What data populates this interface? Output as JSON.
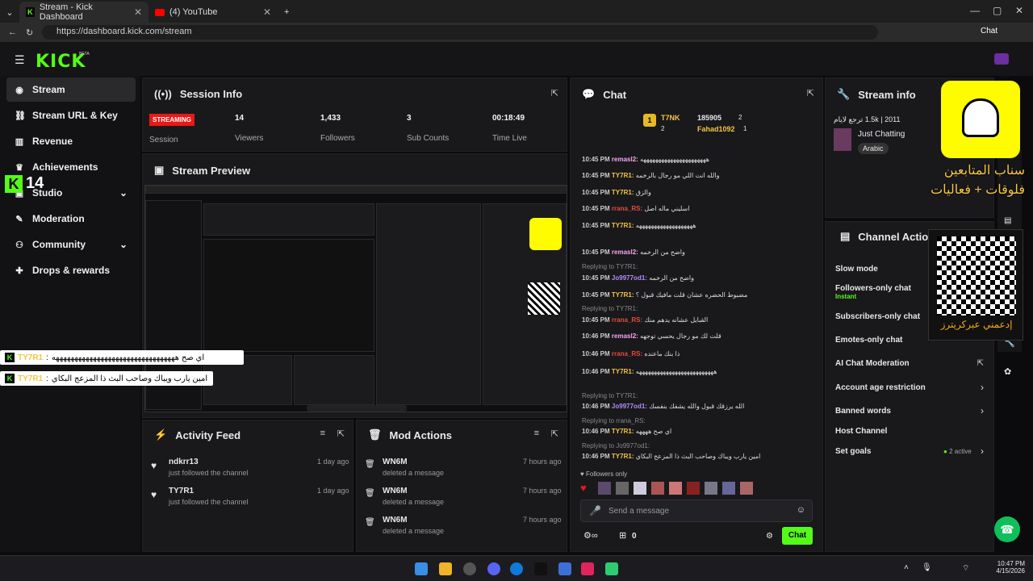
{
  "browser": {
    "tabs": [
      {
        "title": "Stream - Kick Dashboard"
      },
      {
        "title": "(4) YouTube"
      }
    ],
    "url": "https://dashboard.kick.com/stream",
    "chat_button": "Chat"
  },
  "app": {
    "logo": "KICK",
    "beta": "BETA"
  },
  "sidebar": {
    "items": [
      {
        "label": "Stream",
        "icon": "broadcast-icon"
      },
      {
        "label": "Stream URL & Key",
        "icon": "link-icon"
      },
      {
        "label": "Revenue",
        "icon": "chart-icon"
      },
      {
        "label": "Achievements",
        "icon": "trophy-icon"
      },
      {
        "label": "Studio",
        "icon": "studio-icon"
      },
      {
        "label": "Moderation",
        "icon": "wrench-icon"
      },
      {
        "label": "Community",
        "icon": "users-icon"
      },
      {
        "label": "Drops & rewards",
        "icon": "gift-icon"
      }
    ]
  },
  "overlay": {
    "kick_count": "14"
  },
  "session_info": {
    "title": "Session Info",
    "status": "STREAMING",
    "status_label": "Session",
    "stats": [
      {
        "value": "14",
        "label": "Viewers"
      },
      {
        "value": "1,433",
        "label": "Followers"
      },
      {
        "value": "3",
        "label": "Sub Counts"
      },
      {
        "value": "00:18:49",
        "label": "Time Live"
      }
    ]
  },
  "stream_preview": {
    "title": "Stream Preview"
  },
  "overlay_chat": [
    {
      "user": "TY7R1",
      "text": "اي صح هههههههههههههههههههههههههههههههههه"
    },
    {
      "user": "TY7R1",
      "text": "امين يارب ويباك وصاحب البث ذا المزعج البكاي"
    }
  ],
  "activity_feed": {
    "title": "Activity Feed",
    "items": [
      {
        "name": "ndkrr13",
        "sub": "just followed the channel",
        "time": "1 day ago"
      },
      {
        "name": "TY7R1",
        "sub": "just followed the channel",
        "time": "1 day ago"
      }
    ]
  },
  "mod_actions": {
    "title": "Mod Actions",
    "items": [
      {
        "name": "WN6M",
        "sub": "deleted a message",
        "time": "7 hours ago"
      },
      {
        "name": "WN6M",
        "sub": "deleted a message",
        "time": "7 hours ago"
      },
      {
        "name": "WN6M",
        "sub": "deleted a message",
        "time": "7 hours ago"
      }
    ]
  },
  "chat": {
    "title": "Chat",
    "leaders": {
      "first": "T7NK",
      "first_count": "2",
      "second": "185905",
      "second_count": "2",
      "third": "Fahad1092",
      "third_count": "1",
      "rank": "1"
    },
    "lines": [
      {
        "time": "10:45 PM",
        "user": "remasl2:",
        "color": "#f7a6f0",
        "text": "ههههههههههههههههههههههه"
      },
      {
        "time": "10:45 PM",
        "user": "TY7R1:",
        "color": "#f5c542",
        "text": "والله انت اللي مو رجال بالرخمه"
      },
      {
        "time": "10:45 PM",
        "user": "TY7R1:",
        "color": "#f5c542",
        "text": "والزق"
      },
      {
        "time": "10:45 PM",
        "user": "rrana_RS:",
        "color": "#e74c3c",
        "text": "اسليني ماله اصل"
      },
      {
        "time": "10:45 PM",
        "user": "TY7R1:",
        "color": "#f5c542",
        "text": "هههههههههههههههههههه"
      },
      {
        "time": "10:45 PM",
        "user": "remasl2:",
        "color": "#f7a6f0",
        "text": "واضح من الرخمه"
      },
      {
        "time": "10:45 PM",
        "user": "Jo9977od1:",
        "color": "#b48cf5",
        "text": "واضح من الرخمه"
      },
      {
        "time": "10:45 PM",
        "user": "TY7R1:",
        "color": "#f5c542",
        "text": "مضبوط الحضره عشان قلت مافيك قبول ؟"
      },
      {
        "time": "10:45 PM",
        "user": "rrana_RS:",
        "color": "#e74c3c",
        "text": "القبايل عشانه يدهم منك"
      },
      {
        "time": "10:46 PM",
        "user": "remasl2:",
        "color": "#f7a6f0",
        "text": "قلت لك مو رجال يحسي توجهه"
      },
      {
        "time": "10:46 PM",
        "user": "rrana_RS:",
        "color": "#e74c3c",
        "text": "ذا بنك ماعنده"
      },
      {
        "time": "10:46 PM",
        "user": "TY7R1:",
        "color": "#f5c542",
        "text": "ههههههههههههههههههههههههههه"
      },
      {
        "time": "10:46 PM",
        "user": "Jo9977od1:",
        "color": "#b48cf5",
        "text": "الله يرزقك قبول والله يشفك بنفسك"
      },
      {
        "time": "10:46 PM",
        "user": "TY7R1:",
        "color": "#f5c542",
        "text": "اي صح ههههه"
      },
      {
        "time": "10:46 PM",
        "user": "TY7R1:",
        "color": "#f5c542",
        "text": "امين يارب ويباك وصاحب البث ذا المزعج البكاي"
      }
    ],
    "replies": [
      "Replying to TY7R1:",
      "Replying to TY7R1:",
      "Replying to TY7R1:",
      "Replying to rrana_RS:",
      "Replying to Jo9977od1:"
    ],
    "followers_only": "Followers only",
    "placeholder": "Send a message",
    "count": "0",
    "send": "Chat"
  },
  "stream_info": {
    "title": "Stream info",
    "line": "1.5k | 2011 ترجع لايام",
    "category": "Just Chatting",
    "tag": "Arabic"
  },
  "channel_actions": {
    "title": "Channel Actions",
    "items": [
      {
        "label": "Slow mode"
      },
      {
        "label": "Followers-only chat",
        "sub": "Instant"
      },
      {
        "label": "Subscribers-only chat"
      },
      {
        "label": "Emotes-only chat"
      },
      {
        "label": "AI Chat Moderation"
      },
      {
        "label": "Account age restriction"
      },
      {
        "label": "Banned words"
      },
      {
        "label": "Host Channel"
      },
      {
        "label": "Set goals",
        "sub": "2 active"
      }
    ]
  },
  "promo": {
    "snap_line1": "سناب المتابعين",
    "snap_line2": "فلوقات + فعاليات",
    "qr_caption": "إدعمني عبركريترز"
  },
  "taskbar": {
    "time": "10:47 PM",
    "date": "4/15/2026"
  }
}
